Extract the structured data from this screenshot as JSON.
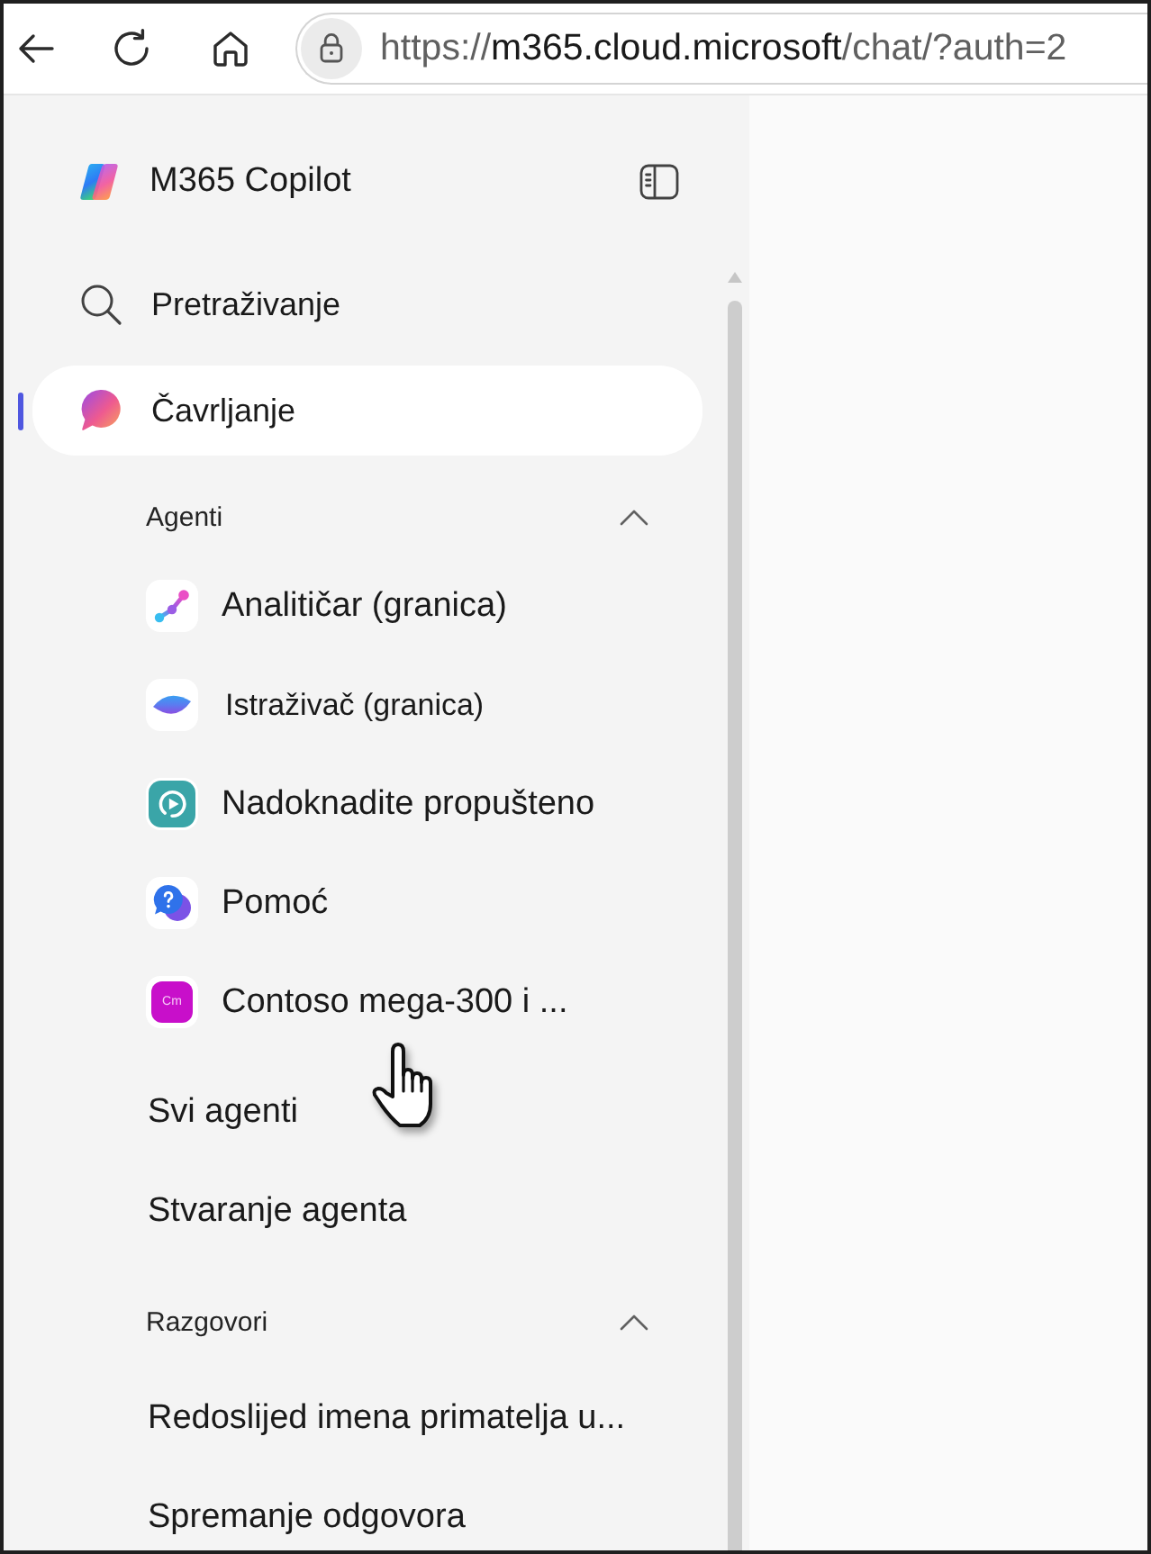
{
  "browser_toolbar": {
    "url": {
      "scheme": "https://",
      "host": "m365.cloud.microsoft",
      "path": "/chat/?auth=2"
    }
  },
  "sidebar": {
    "title": "M365 Copilot",
    "nav": [
      {
        "kind": "search",
        "label": "Pretraživanje",
        "selected": false
      },
      {
        "kind": "chat",
        "label": "Čavrljanje",
        "selected": true
      }
    ],
    "sections": [
      {
        "title": "Agenti",
        "expanded": true,
        "items": [
          {
            "kind": "agent",
            "label": "Analitičar (granica)"
          },
          {
            "kind": "agent",
            "label": "Istraživač (granica)"
          },
          {
            "kind": "agent",
            "label": "Nadoknadite propušteno"
          },
          {
            "kind": "agent",
            "label": "Pomoć"
          },
          {
            "kind": "agent",
            "label": "Contoso mega-300 i ...",
            "monogram": "Cm"
          },
          {
            "kind": "action",
            "label": "Svi agenti"
          },
          {
            "kind": "action",
            "label": "Stvaranje agenta"
          }
        ]
      },
      {
        "title": "Razgovori",
        "expanded": true,
        "items": [
          {
            "kind": "conversation",
            "label": "Redoslijed imena primatelja u..."
          },
          {
            "kind": "conversation",
            "label": "Spremanje odgovora"
          }
        ]
      }
    ]
  }
}
